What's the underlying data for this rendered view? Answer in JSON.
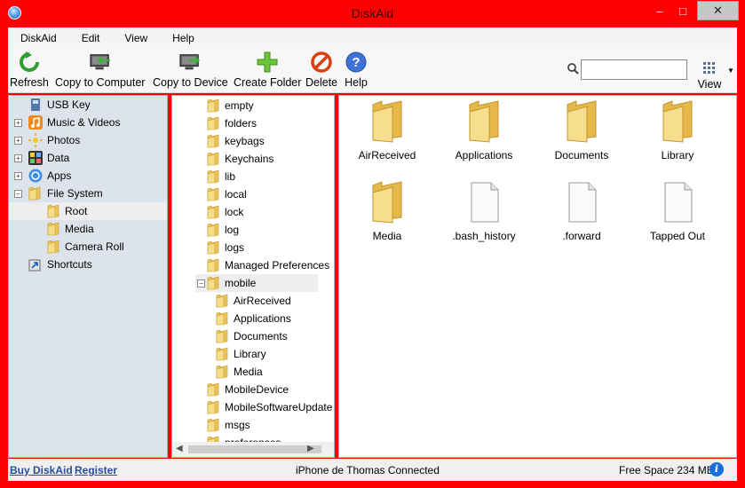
{
  "window": {
    "title": "DiskAid",
    "minimize": "–",
    "maximize": "□",
    "close": "✕"
  },
  "menu": [
    "DiskAid",
    "Edit",
    "View",
    "Help"
  ],
  "toolbar": {
    "refresh": "Refresh",
    "copy_to_computer": "Copy to Computer",
    "copy_to_device": "Copy to Device",
    "create_folder": "Create Folder",
    "delete": "Delete",
    "help": "Help",
    "search_value": "",
    "view": "View"
  },
  "sidebar": {
    "items": [
      {
        "label": "USB Key",
        "icon": "usb-key-icon",
        "expander": ""
      },
      {
        "label": "Music & Videos",
        "icon": "music-icon",
        "expander": "+"
      },
      {
        "label": "Photos",
        "icon": "photos-icon",
        "expander": "+"
      },
      {
        "label": "Data",
        "icon": "data-icon",
        "expander": "+"
      },
      {
        "label": "Apps",
        "icon": "apps-icon",
        "expander": "+"
      },
      {
        "label": "File System",
        "icon": "folder-icon",
        "expander": "−"
      },
      {
        "label": "Root",
        "icon": "folder-icon",
        "expander": "",
        "selected": true
      },
      {
        "label": "Media",
        "icon": "folder-icon",
        "expander": ""
      },
      {
        "label": "Camera Roll",
        "icon": "folder-icon",
        "expander": ""
      },
      {
        "label": "Shortcuts",
        "icon": "shortcut-icon",
        "expander": ""
      }
    ]
  },
  "tree": {
    "items": [
      {
        "label": "empty",
        "level": 0
      },
      {
        "label": "folders",
        "level": 0
      },
      {
        "label": "keybags",
        "level": 0
      },
      {
        "label": "Keychains",
        "level": 0
      },
      {
        "label": "lib",
        "level": 0
      },
      {
        "label": "local",
        "level": 0
      },
      {
        "label": "lock",
        "level": 0
      },
      {
        "label": "log",
        "level": 0
      },
      {
        "label": "logs",
        "level": 0
      },
      {
        "label": "Managed Preferences",
        "level": 0
      },
      {
        "label": "mobile",
        "level": 0,
        "expander": "−",
        "selected": true
      },
      {
        "label": "AirReceived",
        "level": 1
      },
      {
        "label": "Applications",
        "level": 1
      },
      {
        "label": "Documents",
        "level": 1
      },
      {
        "label": "Library",
        "level": 1
      },
      {
        "label": "Media",
        "level": 1
      },
      {
        "label": "MobileDevice",
        "level": 0
      },
      {
        "label": "MobileSoftwareUpdate",
        "level": 0
      },
      {
        "label": "msgs",
        "level": 0
      },
      {
        "label": "preferences",
        "level": 0
      }
    ]
  },
  "files": [
    {
      "label": "AirReceived",
      "type": "folder"
    },
    {
      "label": "Applications",
      "type": "folder"
    },
    {
      "label": "Documents",
      "type": "folder"
    },
    {
      "label": "Library",
      "type": "folder"
    },
    {
      "label": "Media",
      "type": "folder"
    },
    {
      "label": ".bash_history",
      "type": "file"
    },
    {
      "label": ".forward",
      "type": "file"
    },
    {
      "label": "Tapped Out",
      "type": "file"
    }
  ],
  "status": {
    "buy": "Buy DiskAid",
    "register": "Register",
    "connection": "iPhone de Thomas Connected",
    "free_space": "Free Space 234 MB",
    "info": "i"
  },
  "colors": {
    "frame": "#ff0000",
    "folder": "#f2d27a",
    "link": "#2a4d9c"
  }
}
